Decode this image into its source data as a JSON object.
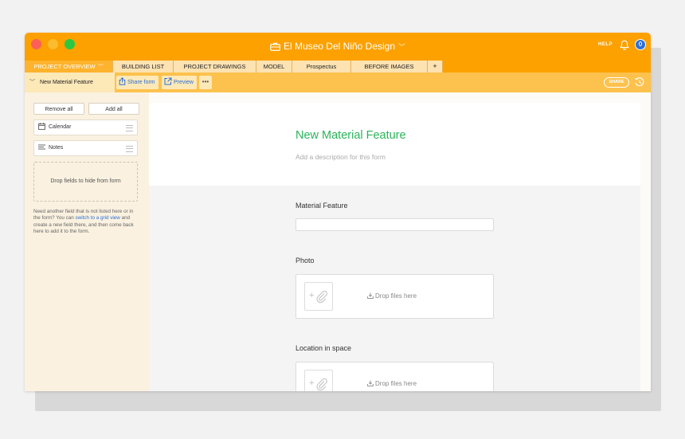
{
  "window": {
    "title": "El Museo Del Niño Design",
    "help_label": "HELP"
  },
  "tabs": [
    {
      "label": "PROJECT OVERVIEW",
      "active": true
    },
    {
      "label": "BUILDING LIST",
      "active": false
    },
    {
      "label": "PROJECT DRAWINGS",
      "active": false
    },
    {
      "label": "MODEL",
      "active": false
    },
    {
      "label": "Prospectus",
      "active": false
    },
    {
      "label": "BEFORE IMAGES",
      "active": false
    },
    {
      "label": "+",
      "active": false
    }
  ],
  "toolbar": {
    "view_name": "New Material Feature",
    "share_form_label": "Share form",
    "preview_label": "Preview",
    "more_label": "•••",
    "share_label": "SHARE"
  },
  "sidebar": {
    "remove_all_label": "Remove all",
    "add_all_label": "Add all",
    "fields": [
      {
        "label": "Calendar",
        "icon": "calendar-icon"
      },
      {
        "label": "Notes",
        "icon": "long-text-icon"
      }
    ],
    "drop_zone_label": "Drop fields to hide from form",
    "help_text_before": "Need another field that is not listed here or in the form? You can ",
    "help_link": "switch to a grid view",
    "help_text_after": " and create a new field there, and then come back here to add it to the form."
  },
  "form": {
    "title": "New Material Feature",
    "description_placeholder": "Add a description for this form",
    "fields": [
      {
        "label": "Material Feature",
        "type": "text",
        "value": ""
      },
      {
        "label": "Photo",
        "type": "attachment",
        "drop_label": "Drop files here"
      },
      {
        "label": "Location in space",
        "type": "attachment",
        "drop_label": "Drop files here"
      }
    ]
  },
  "colors": {
    "accent_orange": "#fca100",
    "toolbar_yellow": "#fdc24d",
    "title_green": "#2bb35a",
    "link_blue": "#2a6fd3"
  }
}
